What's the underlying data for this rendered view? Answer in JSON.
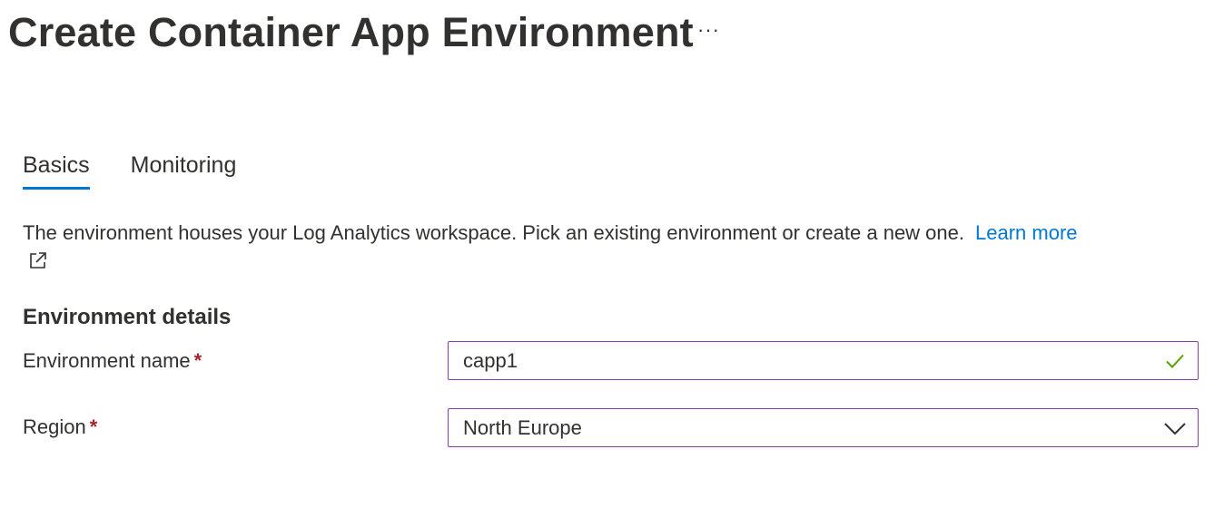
{
  "header": {
    "title": "Create Container App Environment",
    "more_label": "···"
  },
  "tabs": [
    {
      "label": "Basics",
      "active": true
    },
    {
      "label": "Monitoring",
      "active": false
    }
  ],
  "description": {
    "text": "The environment houses your Log Analytics workspace. Pick an existing environment or create a new one.",
    "link_label": "Learn more",
    "link_icon": "external-link-icon"
  },
  "section": {
    "title": "Environment details"
  },
  "form": {
    "environment_name": {
      "label": "Environment name",
      "required_mark": "*",
      "value": "capp1",
      "status_icon": "checkmark-icon",
      "status_color": "#57a300"
    },
    "region": {
      "label": "Region",
      "required_mark": "*",
      "value": "North Europe",
      "icon": "chevron-down-icon"
    }
  },
  "colors": {
    "accent": "#0078d4",
    "field_border": "#8a3da3",
    "required": "#a4262c",
    "text": "#323130"
  }
}
